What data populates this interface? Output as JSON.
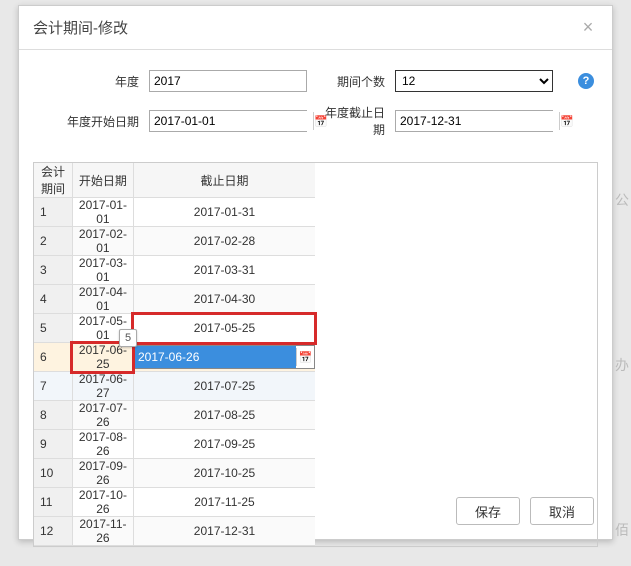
{
  "dialog": {
    "title": "会计期间-修改",
    "close_glyph": "×"
  },
  "form": {
    "year_label": "年度",
    "year_value": "2017",
    "count_label": "期间个数",
    "count_value": "12",
    "start_label": "年度开始日期",
    "start_value": "2017-01-01",
    "end_label": "年度截止日期",
    "end_value": "2017-12-31",
    "help_glyph": "?"
  },
  "table": {
    "headers": {
      "period": "会计期间",
      "start": "开始日期",
      "end": "截止日期"
    },
    "rows": [
      {
        "p": "1",
        "s": "2017-01-01",
        "e": "2017-01-31"
      },
      {
        "p": "2",
        "s": "2017-02-01",
        "e": "2017-02-28"
      },
      {
        "p": "3",
        "s": "2017-03-01",
        "e": "2017-03-31"
      },
      {
        "p": "4",
        "s": "2017-04-01",
        "e": "2017-04-30"
      },
      {
        "p": "5",
        "s": "2017-05-01",
        "e": "2017-05-25"
      },
      {
        "p": "6",
        "s": "2017-06-25",
        "e": "2017-06-26"
      },
      {
        "p": "7",
        "s": "2017-06-27",
        "e": "2017-07-25"
      },
      {
        "p": "8",
        "s": "2017-07-26",
        "e": "2017-08-25"
      },
      {
        "p": "9",
        "s": "2017-08-26",
        "e": "2017-09-25"
      },
      {
        "p": "10",
        "s": "2017-09-26",
        "e": "2017-10-25"
      },
      {
        "p": "11",
        "s": "2017-10-26",
        "e": "2017-11-25"
      },
      {
        "p": "12",
        "s": "2017-11-26",
        "e": "2017-12-31"
      }
    ],
    "tooltip": "5"
  },
  "footer": {
    "save": "保存",
    "cancel": "取消"
  },
  "bg_hints": [
    "公",
    "办",
    "佰"
  ]
}
